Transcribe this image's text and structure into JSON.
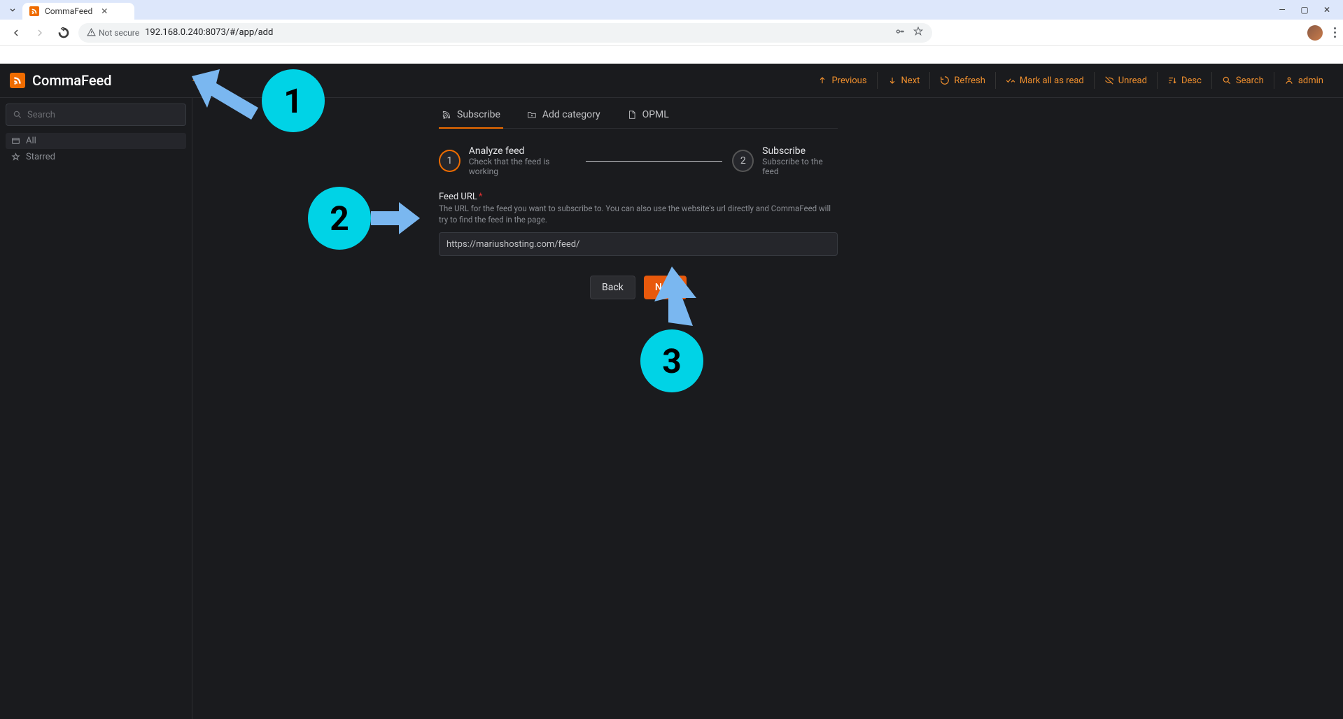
{
  "browser": {
    "tab_title": "CommaFeed",
    "not_secure": "Not secure",
    "url": "192.168.0.240:8073/#/app/add"
  },
  "app": {
    "brand": "CommaFeed",
    "search_placeholder": "Search",
    "sidebar": {
      "all": "All",
      "starred": "Starred"
    },
    "toolbar": {
      "previous": "Previous",
      "next": "Next",
      "refresh": "Refresh",
      "mark_all_read": "Mark all as read",
      "unread": "Unread",
      "desc": "Desc",
      "search": "Search",
      "admin": "admin"
    },
    "tabs": {
      "subscribe": "Subscribe",
      "add_category": "Add category",
      "opml": "OPML"
    },
    "stepper": {
      "step1": {
        "num": "1",
        "title": "Analyze feed",
        "sub": "Check that the feed is working"
      },
      "step2": {
        "num": "2",
        "title": "Subscribe",
        "sub": "Subscribe to the feed"
      }
    },
    "form": {
      "feed_url_label": "Feed URL",
      "required_mark": "*",
      "feed_url_help": "The URL for the feed you want to subscribe to. You can also use the website's url directly and CommaFeed will try to find the feed in the page.",
      "feed_url_value": "https://mariushosting.com/feed/",
      "back": "Back",
      "next": "Next"
    }
  },
  "annotations": {
    "n1": "1",
    "n2": "2",
    "n3": "3"
  }
}
